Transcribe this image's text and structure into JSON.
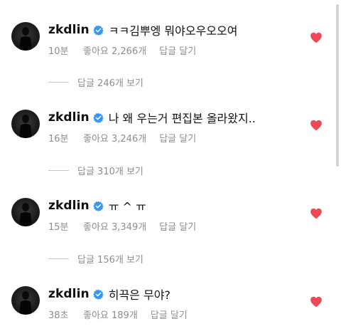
{
  "comments": [
    {
      "username": "zkdlin",
      "text": "ㅋㅋ김뿌엥 뭐야오우오오여",
      "time": "10분",
      "likes": "좋아요 2,266개",
      "reply_label": "답글 달기",
      "view_replies": "답글 246개 보기"
    },
    {
      "username": "zkdlin",
      "text": "나 왜 우는거 편집본 올라왔지..",
      "time": "16분",
      "likes": "좋아요 3,246개",
      "reply_label": "답글 달기",
      "view_replies": "답글 310개 보기"
    },
    {
      "username": "zkdlin",
      "text": "ㅠ ^ ㅠ",
      "time": "15분",
      "likes": "좋아요 3,349개",
      "reply_label": "답글 달기",
      "view_replies": "답글 156개 보기"
    },
    {
      "username": "zkdlin",
      "text": "히끅은 무야?",
      "time": "38초",
      "likes": "좋아요 189개",
      "reply_label": "답글 달기"
    }
  ],
  "colors": {
    "heart": "#ed4956",
    "verified": "#3897f0",
    "secondary_text": "#8e8e8e"
  },
  "icons": {
    "verified": "verified-badge-icon",
    "like": "heart-icon"
  }
}
